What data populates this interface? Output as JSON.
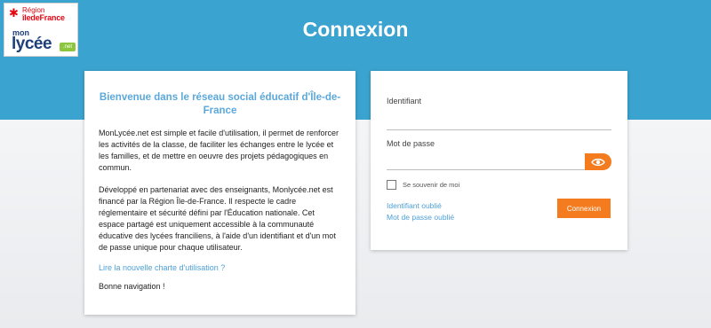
{
  "logo": {
    "region_line1": "Région",
    "region_line2": "îledeFrance",
    "mon": "mon",
    "lycee": "lycée",
    "net": ".net"
  },
  "header": {
    "title": "Connexion"
  },
  "welcome": {
    "title": "Bienvenue dans le réseau social éducatif d'Île-de-France",
    "paragraph1": "MonLycée.net est simple et facile d'utilisation, il permet de renforcer les activités de la classe, de faciliter les échanges entre le lycée et les familles, et de mettre en oeuvre des projets pédagogiques en commun.",
    "paragraph2": "Développé en partenariat avec des enseignants, Monlycée.net est financé par la Région Île-de-France. Il respecte le cadre réglementaire et sécurité défini par l'Éducation nationale. Cet espace partagé est uniquement accessible à la communauté éducative des lycées franciliens, à l'aide d'un identifiant et d'un mot de passe unique pour chaque utilisateur.",
    "charter_link": "Lire la nouvelle charte d'utilisation ?",
    "closing": "Bonne navigation !"
  },
  "login": {
    "identifier_label": "Identifiant",
    "identifier_value": "",
    "password_label": "Mot de passe",
    "password_value": "",
    "remember_label": "Se souvenir de moi",
    "remember_checked": false,
    "forgot_identifier": "Identifiant oublié",
    "forgot_password": "Mot de passe oublié",
    "submit_label": "Connexion"
  },
  "colors": {
    "header_band": "#3ba3cf",
    "accent_orange": "#f47c1f",
    "link_blue": "#4d9fd6",
    "region_red": "#e30613",
    "lycee_navy": "#1d3f7a"
  },
  "icons": {
    "show_password": "eye-icon",
    "region_logo": "star-icon"
  }
}
